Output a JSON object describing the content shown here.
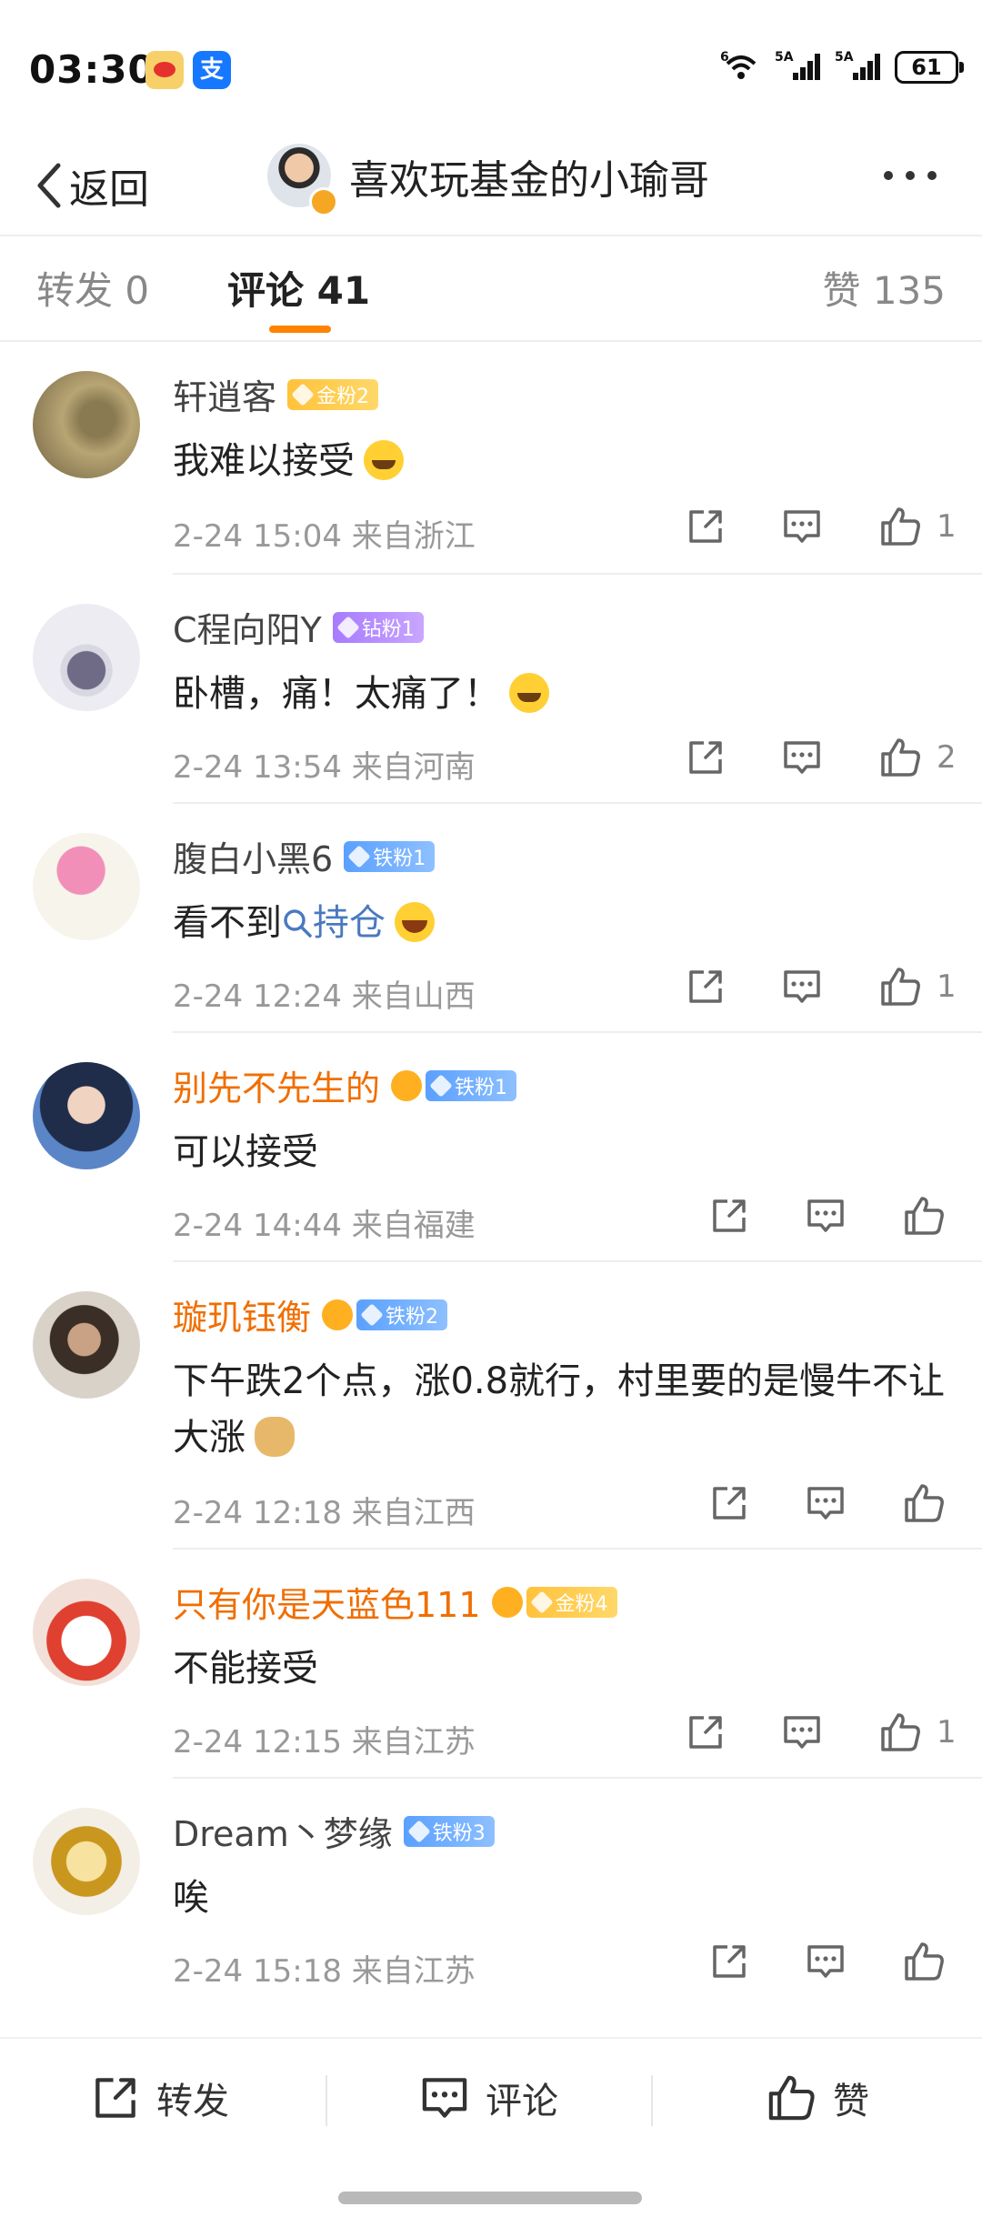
{
  "status_bar": {
    "time": "03:30",
    "sig1": "6",
    "sig2": "5A",
    "sig3": "5A",
    "battery": "61"
  },
  "nav": {
    "back_label": "返回",
    "author": "喜欢玩基金的小瑜哥"
  },
  "tabs": {
    "repost": "转发 0",
    "comment": "评论 41",
    "like": "赞 135"
  },
  "comments": [
    {
      "name": "轩逍客",
      "badge": "金粉2",
      "text": "我难以接受",
      "meta": "2-24 15:04 来自浙江",
      "likes": "1"
    },
    {
      "name": "C程向阳Y",
      "badge": "钻粉1",
      "text": "卧槽，痛！太痛了！",
      "meta": "2-24 13:54 来自河南",
      "likes": "2"
    },
    {
      "name": "腹白小黑6",
      "badge": "铁粉1",
      "text": "看不到",
      "link": "持仓",
      "meta": "2-24 12:24 来自山西",
      "likes": "1"
    },
    {
      "name": "别先不先生的",
      "badge": "铁粉1",
      "text": "可以接受",
      "meta": "2-24 14:44 来自福建",
      "likes": ""
    },
    {
      "name": "璇玑钰衡",
      "badge": "铁粉2",
      "text": "下午跌2个点，涨0.8就行，村里要的是慢牛不让大涨",
      "meta": "2-24 12:18 来自江西",
      "likes": ""
    },
    {
      "name": "只有你是天蓝色111",
      "badge": "金粉4",
      "text": "不能接受",
      "meta": "2-24 12:15 来自江苏",
      "likes": "1"
    },
    {
      "name": "Dream丶梦缘",
      "badge": "铁粉3",
      "text": "唉",
      "meta": "2-24 15:18 来自江苏",
      "likes": ""
    }
  ],
  "bottom_bar": {
    "repost": "转发",
    "comment": "评论",
    "like": "赞"
  },
  "colors": {
    "accent": "#ff8200",
    "vip_name": "#f06e00",
    "link": "#4a79c0"
  }
}
